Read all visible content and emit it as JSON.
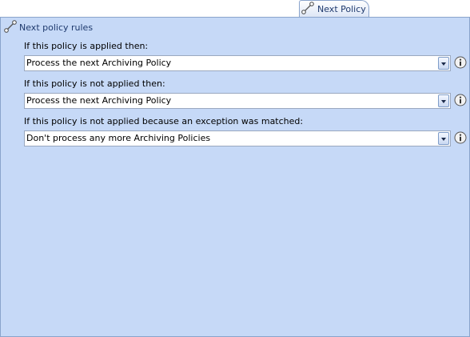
{
  "tab": {
    "label": "Next Policy",
    "icon": "policy-link-icon"
  },
  "section": {
    "title": "Next policy rules",
    "icon": "policy-link-icon"
  },
  "rules": [
    {
      "question": "If this policy is applied then:",
      "value": "Process the next Archiving Policy"
    },
    {
      "question": "If this policy is not applied then:",
      "value": "Process the next Archiving Policy"
    },
    {
      "question": "If this policy is not applied because an exception was matched:",
      "value": "Don't process any more Archiving Policies"
    }
  ],
  "colors": {
    "panel_background": "#c6d9f7",
    "title_text": "#1f3a6e",
    "border": "#8aa4cc"
  }
}
